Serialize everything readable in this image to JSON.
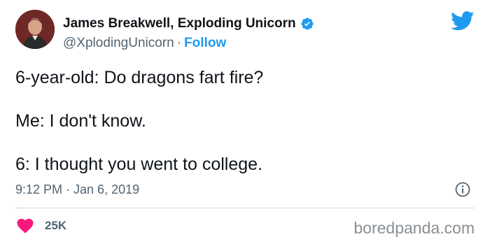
{
  "author": {
    "name": "James Breakwell, Exploding Unicorn",
    "handle": "@XplodingUnicorn",
    "follow_label": "Follow",
    "separator": "·"
  },
  "tweet": {
    "line1": "6-year-old: Do dragons fart fire?",
    "line2": "Me: I don't know.",
    "line3": "6: I thought you went to college.",
    "timestamp": "9:12 PM · Jan 6, 2019"
  },
  "engagement": {
    "likes": "25K"
  },
  "watermark": "boredpanda.com",
  "icons": {
    "verified": "verified-badge-icon",
    "twitter": "twitter-bird-icon",
    "info": "info-icon",
    "heart": "heart-icon"
  },
  "colors": {
    "twitter_blue": "#1d9bf0",
    "heart": "#f91880",
    "text": "#0f1419",
    "muted": "#536471"
  }
}
